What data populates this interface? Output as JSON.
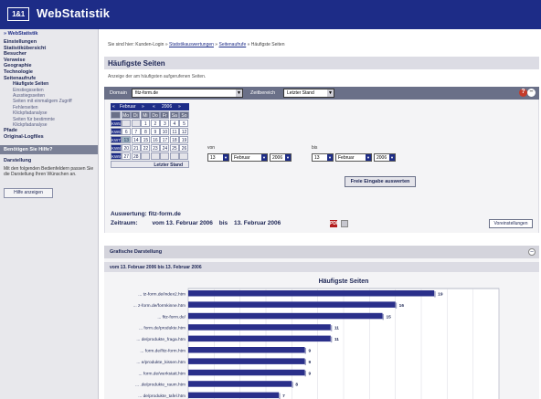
{
  "header": {
    "logo": "1&1",
    "title": "WebStatistik"
  },
  "sidebar": {
    "header": "» WebStatistik",
    "items": [
      {
        "label": "Einstellungen",
        "sub": false,
        "selected": false
      },
      {
        "label": "Statistikübersicht",
        "sub": false,
        "selected": false
      },
      {
        "label": "Besucher",
        "sub": false,
        "selected": false
      },
      {
        "label": "Verweise",
        "sub": false,
        "selected": false
      },
      {
        "label": "Geographie",
        "sub": false,
        "selected": false
      },
      {
        "label": "Technologie",
        "sub": false,
        "selected": false
      },
      {
        "label": "Seitenaufrufe",
        "sub": false,
        "selected": false
      },
      {
        "label": "Häufigste Seiten",
        "sub": true,
        "selected": true
      },
      {
        "label": "Einstiegsseiten",
        "sub": true,
        "selected": false
      },
      {
        "label": "Ausstiegsseiten",
        "sub": true,
        "selected": false
      },
      {
        "label": "Seiten mit einmaligem Zugriff",
        "sub": true,
        "selected": false
      },
      {
        "label": "Fehlerseiten",
        "sub": true,
        "selected": false
      },
      {
        "label": "Klickpfadanalyse",
        "sub": true,
        "selected": false
      },
      {
        "label": "Seiten für bestimmte",
        "sub": true,
        "selected": false
      },
      {
        "label": "Klickpfadanalyse",
        "sub": true,
        "selected": false
      },
      {
        "label": "Pfade",
        "sub": false,
        "selected": false
      },
      {
        "label": "Original-Logfiles",
        "sub": false,
        "selected": false
      }
    ],
    "help_header": "Benötigen Sie Hilfe?",
    "help_title": "Darstellung",
    "help_text": "Mit den folgenden Bedienfeldern passen Sie die Darstellung Ihren Wünschen an.",
    "help_button": "Hilfe anzeigen"
  },
  "breadcrumb": {
    "prefix": "Sie sind hier: Kunden-Login » ",
    "link1": "Statistikauswertungen",
    "sep1": " » ",
    "link2": "Seitenaufrufe",
    "sep2": " » ",
    "current": "Häufigste Seiten"
  },
  "page": {
    "title": "Häufigste Seiten",
    "description": "Anzeige der am häufigsten aufgerufenen Seiten."
  },
  "filter": {
    "domain_label": "Domain",
    "domain_value": "fitz-form.de",
    "period_label": "Zeitbereich",
    "period_value": "Letzter Stand",
    "from_label": "von",
    "to_label": "bis",
    "from_day": "13",
    "from_month": "Februar",
    "from_year": "2006",
    "to_day": "13",
    "to_month": "Februar",
    "to_year": "2006",
    "eval_button": "Freie Eingabe auswerten",
    "evaluation": "Auswertung: fitz-form.de",
    "period_prefix": "Zeitraum:",
    "period_from": "vom 13. Februar 2006",
    "period_mid": "bis",
    "period_to": "13. Februar 2006",
    "pdf_icon_label": "PDF",
    "settings_button": "Voreinstellungen"
  },
  "calendar": {
    "month": "Februar",
    "year": "2006",
    "prev": "«",
    "next": "»",
    "dow": [
      "Mo",
      "Di",
      "Mi",
      "Do",
      "Fr",
      "Sa",
      "So"
    ],
    "footer": "Letzter Stand",
    "weeks": [
      {
        "kw": "KW5",
        "days": [
          "",
          "",
          "1",
          "2",
          "3",
          "4",
          "5"
        ]
      },
      {
        "kw": "KW6",
        "days": [
          "6",
          "7",
          "8",
          "9",
          "10",
          "11",
          "12"
        ]
      },
      {
        "kw": "KW7",
        "days": [
          "13",
          "14",
          "15",
          "16",
          "17",
          "18",
          "19"
        ]
      },
      {
        "kw": "KW8",
        "days": [
          "20",
          "21",
          "22",
          "23",
          "24",
          "25",
          "26"
        ]
      },
      {
        "kw": "KW9",
        "days": [
          "27",
          "28",
          "",
          "",
          "",
          "",
          ""
        ]
      }
    ],
    "today": "13"
  },
  "chart_panel": {
    "title": "Grafische Darstellung",
    "period": "vom 13. Februar 2006 bis 13. Februar 2006"
  },
  "chart_data": {
    "type": "bar",
    "orientation": "horizontal",
    "title": "Häufigste Seiten",
    "categories": [
      "... tz-form.de/index2.htm",
      "... z-form.de/formkinne.htm",
      "... fitz-form.de/",
      "... form.de/produkte.htm",
      "... de/produkte_fraga.htm",
      "... form.de/fitz-form.htm",
      "... e/produkte_kissen.htm",
      "... form.de/werkstatt.htm",
      "... .de/produkte_raum.htm",
      "... de/produkte_tafel.htm"
    ],
    "values": [
      19,
      16,
      15,
      11,
      11,
      9,
      9,
      9,
      8,
      7
    ],
    "xlim": [
      0,
      24
    ],
    "xticks": [
      0,
      2,
      4,
      6,
      8,
      10,
      12,
      14,
      16,
      18,
      20,
      22,
      24
    ],
    "bar_color": "#2a2f8a",
    "grid": true
  }
}
